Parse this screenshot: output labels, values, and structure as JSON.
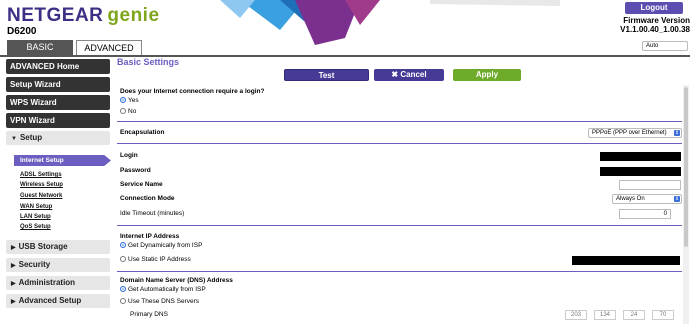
{
  "header": {
    "brand": "NETGEAR",
    "product": "genie",
    "model": "D6200",
    "logout_label": "Logout",
    "firmware_label": "Firmware Version",
    "firmware_value": "V1.1.00.40_1.00.38",
    "language": "Auto",
    "tabs": [
      {
        "label": "BASIC"
      },
      {
        "label": "ADVANCED"
      }
    ]
  },
  "sidebar": {
    "dark_items": [
      {
        "label": "ADVANCED Home"
      },
      {
        "label": "Setup Wizard"
      },
      {
        "label": "WPS Wizard"
      },
      {
        "label": "VPN Wizard"
      }
    ],
    "setup_label": "Setup",
    "setup_sub": [
      {
        "label": "Internet Setup"
      },
      {
        "label": "ADSL Settings"
      },
      {
        "label": "Wireless Setup"
      },
      {
        "label": "Guest Network"
      },
      {
        "label": "WAN Setup"
      },
      {
        "label": "LAN Setup"
      },
      {
        "label": "QoS Setup"
      }
    ],
    "collapsed": [
      {
        "label": "USB Storage"
      },
      {
        "label": "Security"
      },
      {
        "label": "Administration"
      },
      {
        "label": "Advanced Setup"
      }
    ]
  },
  "main": {
    "title": "Basic Settings",
    "buttons": {
      "test": "Test",
      "cancel": "Cancel",
      "apply": "Apply"
    },
    "login_required": {
      "question": "Does your Internet connection require a login?",
      "options": [
        {
          "label": "Yes",
          "selected": true
        },
        {
          "label": "No",
          "selected": false
        }
      ]
    },
    "encapsulation": {
      "label": "Encapsulation",
      "value": "PPPoE (PPP over Ethernet)"
    },
    "login_label": "Login",
    "password_label": "Password",
    "service_name_label": "Service Name",
    "connection_mode": {
      "label": "Connection Mode",
      "value": "Always On"
    },
    "idle_timeout": {
      "label": "Idle Timeout (minutes)",
      "value": "0"
    },
    "internet_ip": {
      "heading": "Internet IP Address",
      "options": [
        {
          "label": "Get Dynamically from ISP",
          "selected": true
        },
        {
          "label": "Use Static IP Address",
          "selected": false
        }
      ]
    },
    "dns": {
      "heading": "Domain Name Server (DNS) Address",
      "options": [
        {
          "label": "Get Automatically from ISP",
          "selected": true
        },
        {
          "label": "Use These DNS Servers",
          "selected": false
        }
      ],
      "primary_label": "Primary DNS",
      "primary_octets": [
        "203",
        "134",
        "24",
        "70"
      ]
    }
  }
}
